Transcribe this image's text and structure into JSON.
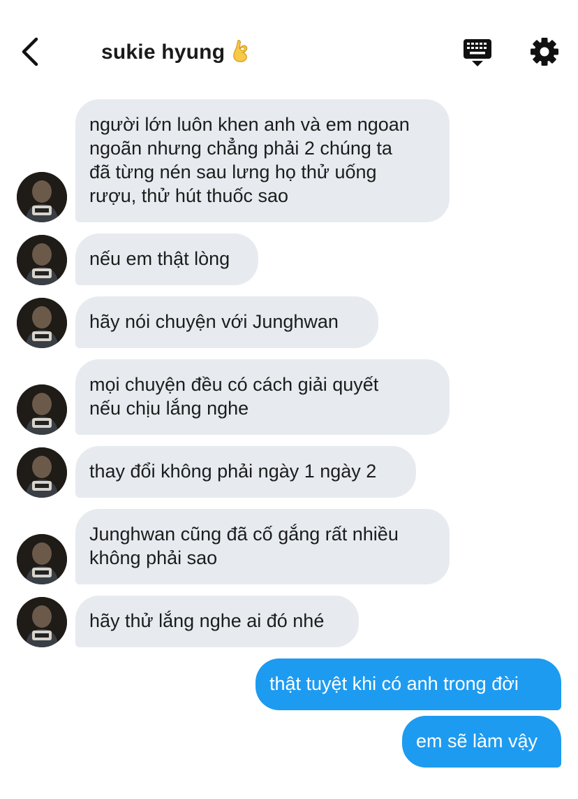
{
  "header": {
    "contact_name": "sukie hyung",
    "name_emoji": "ok-hand-emoji",
    "icons": {
      "back": "back-arrow-icon",
      "keyboard": "keyboard-icon",
      "settings": "gear-icon"
    }
  },
  "messages": [
    {
      "direction": "in",
      "text": "người lớn luôn khen anh và em ngoan\nngoãn nhưng chẳng phải 2 chúng ta\nđã từng nén sau lưng họ thử uống\nrượu, thử hút thuốc sao"
    },
    {
      "direction": "in",
      "text": "nếu em thật lòng"
    },
    {
      "direction": "in",
      "text": "hãy nói chuyện với Junghwan"
    },
    {
      "direction": "in",
      "text": "mọi chuyện đều có cách giải quyết\nnếu chịu lắng nghe"
    },
    {
      "direction": "in",
      "text": "thay đổi không phải ngày 1 ngày 2"
    },
    {
      "direction": "in",
      "text": "Junghwan cũng đã cố gắng rất nhiều\nkhông phải sao"
    },
    {
      "direction": "in",
      "text": "hãy thử lắng nghe ai đó nhé"
    },
    {
      "direction": "out",
      "text": "thật tuyệt khi có anh trong đời"
    },
    {
      "direction": "out",
      "text": "em sẽ làm vậy"
    }
  ],
  "colors": {
    "incoming_bubble": "#e7ebef",
    "outgoing_bubble": "#1d9bf0",
    "text": "#1c1c1c"
  }
}
